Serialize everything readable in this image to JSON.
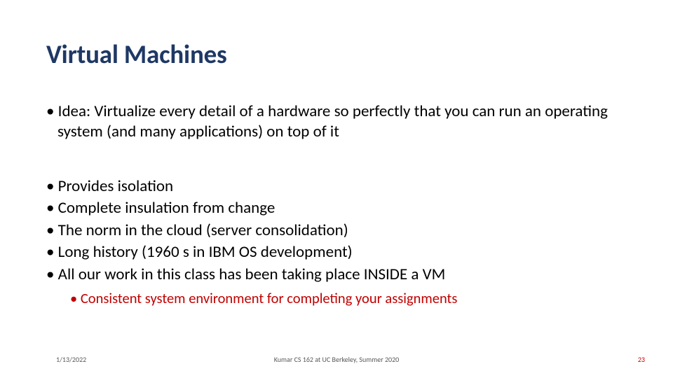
{
  "title": "Virtual Machines",
  "bullets": {
    "idea": "Idea: Virtualize every detail of a hardware so perfectly that you can run an operating system (and many applications) on top of it",
    "b1": "Provides isolation",
    "b2": "Complete insulation from change",
    "b3": "The norm in the cloud (server consolidation)",
    "b4": "Long history (1960 s in IBM OS development)",
    "b5": "All our work in this class has been taking place INSIDE a VM",
    "sub1": "Consistent system environment for completing your assignments"
  },
  "footer": {
    "date": "1/13/2022",
    "center": "Kumar CS 162 at UC Berkeley, Summer 2020",
    "page": "23"
  }
}
